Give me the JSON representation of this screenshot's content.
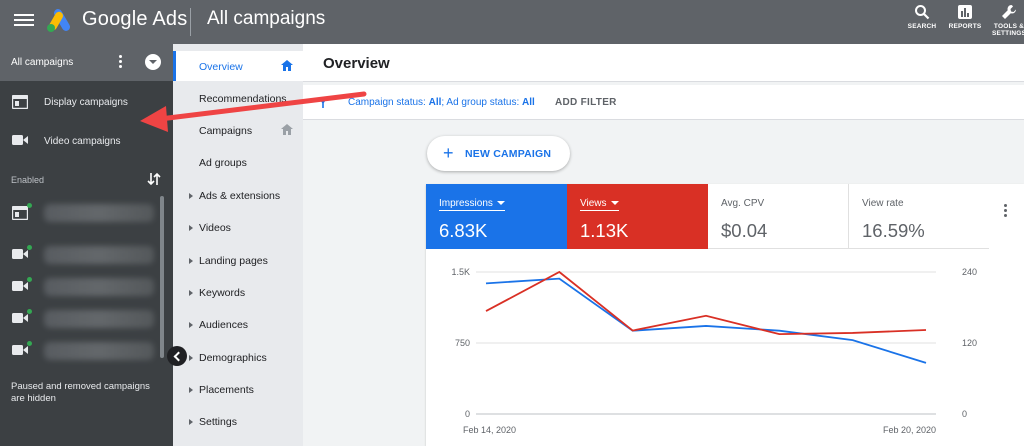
{
  "header": {
    "brand": "Google Ads",
    "page_title": "All campaigns",
    "actions": [
      {
        "label": "SEARCH",
        "icon": "search-icon"
      },
      {
        "label": "REPORTS",
        "icon": "reports-icon"
      },
      {
        "label": "TOOLS & SETTINGS",
        "icon": "wrench-icon"
      }
    ]
  },
  "left_panel": {
    "scope_label": "All campaigns",
    "campaign_types": [
      {
        "label": "Display campaigns",
        "icon": "display-campaign-icon"
      },
      {
        "label": "Video campaigns",
        "icon": "video-campaign-icon"
      }
    ],
    "enabled_label": "Enabled",
    "campaigns": [
      {
        "icon": "display-campaign-icon",
        "status": "enabled"
      },
      {
        "icon": "video-campaign-icon",
        "status": "enabled"
      },
      {
        "icon": "video-campaign-icon",
        "status": "enabled"
      },
      {
        "icon": "video-campaign-icon",
        "status": "enabled"
      },
      {
        "icon": "video-campaign-icon",
        "status": "enabled"
      }
    ],
    "paused_note": "Paused and removed campaigns are hidden"
  },
  "nav": {
    "items": [
      {
        "label": "Overview",
        "active": true,
        "home": true,
        "expandable": false
      },
      {
        "label": "Recommendations",
        "active": false,
        "home": false,
        "expandable": false
      },
      {
        "label": "Campaigns",
        "active": false,
        "home": true,
        "expandable": false
      },
      {
        "label": "Ad groups",
        "active": false,
        "home": false,
        "expandable": false
      },
      {
        "label": "Ads & extensions",
        "active": false,
        "home": false,
        "expandable": true
      },
      {
        "label": "Videos",
        "active": false,
        "home": false,
        "expandable": true
      },
      {
        "label": "Landing pages",
        "active": false,
        "home": false,
        "expandable": true
      },
      {
        "label": "Keywords",
        "active": false,
        "home": false,
        "expandable": true
      },
      {
        "label": "Audiences",
        "active": false,
        "home": false,
        "expandable": true
      },
      {
        "label": "Demographics",
        "active": false,
        "home": false,
        "expandable": true
      },
      {
        "label": "Placements",
        "active": false,
        "home": false,
        "expandable": true
      },
      {
        "label": "Settings",
        "active": false,
        "home": false,
        "expandable": true
      }
    ]
  },
  "main": {
    "title": "Overview",
    "filter": {
      "campaign_status_label": "Campaign status:",
      "campaign_status_value": "All",
      "ad_group_status_label": "; Ad group status:",
      "ad_group_status_value": "All",
      "add_filter": "ADD FILTER"
    },
    "new_campaign": "NEW CAMPAIGN",
    "metrics": [
      {
        "label": "Impressions",
        "value": "6.83K",
        "selected": true,
        "color": "#1a73e8"
      },
      {
        "label": "Views",
        "value": "1.13K",
        "selected": true,
        "color": "#d93025"
      },
      {
        "label": "Avg. CPV",
        "value": "$0.04",
        "selected": false
      },
      {
        "label": "View rate",
        "value": "16.59%",
        "selected": false
      }
    ]
  },
  "chart_data": {
    "type": "line",
    "x_labels": [
      "Feb 14, 2020",
      "Feb 20, 2020"
    ],
    "points": 7,
    "left_axis": {
      "ticks": [
        "0",
        "750",
        "1.5K"
      ],
      "ylim": [
        0,
        1500
      ]
    },
    "right_axis": {
      "ticks": [
        "0",
        "120",
        "240"
      ],
      "ylim": [
        0,
        240
      ]
    },
    "series": [
      {
        "name": "Impressions",
        "axis": "left",
        "color": "#1a73e8",
        "values": [
          1380,
          1430,
          880,
          930,
          880,
          780,
          540
        ]
      },
      {
        "name": "Views",
        "axis": "right",
        "color": "#d93025",
        "values": [
          174,
          240,
          141,
          166,
          135,
          137,
          142
        ]
      }
    ],
    "grid": true
  },
  "colors": {
    "topbar": "#5f6368",
    "accent": "#1a73e8",
    "annotation_arrow": "#ef4444"
  }
}
